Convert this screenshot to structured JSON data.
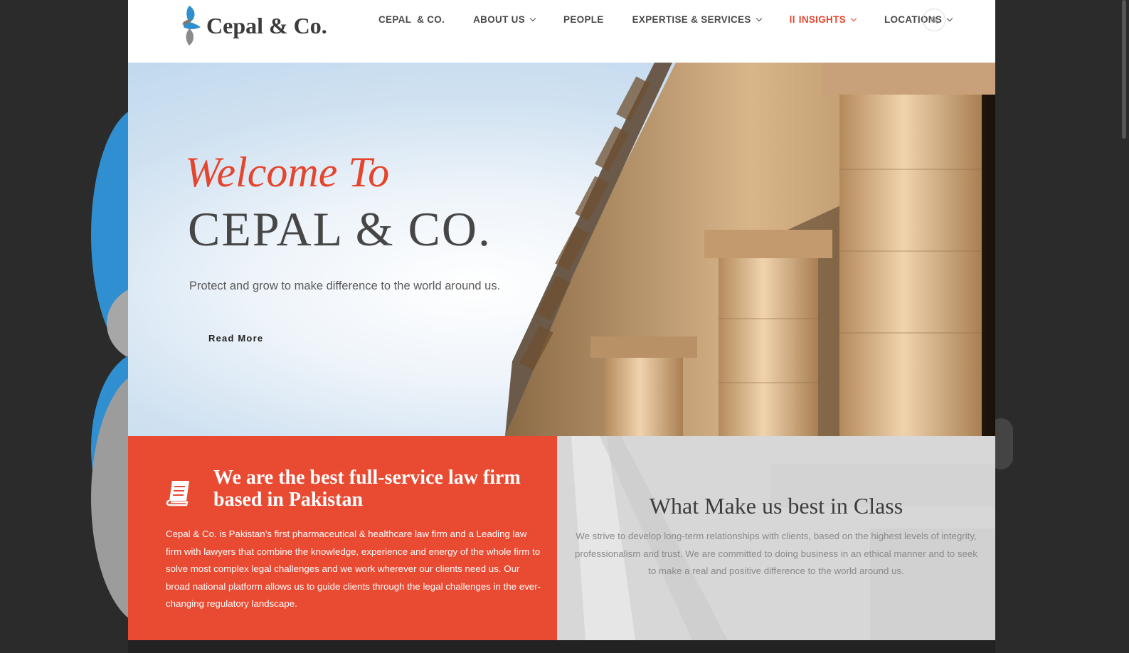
{
  "brand": {
    "name": "Cepal & Co.",
    "accent": "#e5452d",
    "blue": "#2f8fd0"
  },
  "nav": {
    "items": [
      {
        "label": "CEPAL  & CO.",
        "dropdown": false,
        "active": false
      },
      {
        "label": "ABOUT US",
        "dropdown": true,
        "active": false
      },
      {
        "label": "PEOPLE",
        "dropdown": false,
        "active": false
      },
      {
        "label": "EXPERTISE & SERVICES",
        "dropdown": true,
        "active": false
      },
      {
        "label": "INSIGHTS",
        "prefix": "ll",
        "dropdown": true,
        "active": true
      },
      {
        "label": "LOCATIONS",
        "dropdown": true,
        "active": false
      }
    ],
    "search_icon": "search-icon"
  },
  "hero": {
    "welcome": "Welcome To",
    "title": "CEPAL & CO.",
    "tagline": "Protect and grow to make difference to the world around us.",
    "cta": "Read More"
  },
  "feature_red": {
    "icon": "book-icon",
    "title": "We are the best full-service law firm based in Pakistan",
    "body": "Cepal & Co. is Pakistan’s first pharmaceutical & healthcare law firm and a Leading law firm with lawyers that combine the knowledge, experience and energy of the whole firm to solve most complex legal challenges and we work wherever our clients need us. Our broad national platform allows us to guide clients through the legal challenges in the ever-changing regulatory landscape."
  },
  "feature_grey": {
    "title": "What Make us best in Class",
    "body": "We strive to develop long-term relationships with clients, based on the highest levels of integrity, professionalism and trust. We are committed to doing business in an ethical manner and to seek to make a real and positive difference to the world around us."
  }
}
